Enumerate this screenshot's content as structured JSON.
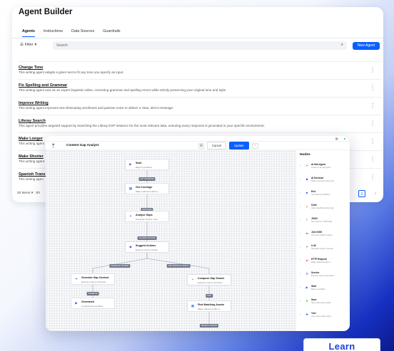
{
  "agent_builder": {
    "title": "Agent Builder",
    "tabs": [
      {
        "label": "Agents",
        "active": true
      },
      {
        "label": "Instructions"
      },
      {
        "label": "Data Sources"
      },
      {
        "label": "Guardrails"
      }
    ],
    "filter_label": "Filter",
    "search_placeholder": "Search",
    "new_agent_label": "New Agent",
    "rows": [
      {
        "name": "Change Tone",
        "desc": "This writing agent adapts a given text to fit any tone you specify as input."
      },
      {
        "name": "Fix Spelling and Grammar",
        "desc": "This writing agent acts as an expert linguistic editor, correcting grammar and spelling errors while strictly preserving your original tone and style."
      },
      {
        "name": "Improve Writing",
        "desc": "This writing agent improves text eliminating wordiness and passive voice to deliver a clear, direct message."
      },
      {
        "name": "Liferay Search",
        "desc": "This agent provides targeted support by searching the Liferay DXP instance for the most relevant data, ensuring every response is grounded in your specific environment."
      },
      {
        "name": "Make Longer",
        "desc": "This writing agent"
      },
      {
        "name": "Make Shorter",
        "desc": "This writing agent"
      },
      {
        "name": "Spanish Translat",
        "desc": "This writing agen"
      }
    ],
    "footer_count": "20 Items",
    "footer_show": "Sh",
    "page_current": "1"
  },
  "workflow": {
    "title": "Content Gap Analyst",
    "cancel_label": "Cancel",
    "update_label": "Update",
    "more_label": "···",
    "nodes": [
      {
        "title": "Start",
        "sub": "Begin a workflow",
        "icon": "▶",
        "color": "#6b4de6"
      },
      {
        "title": "Get Coverage",
        "sub": "Make outbound calls to...",
        "icon": "▦",
        "color": "#0b5fff"
      },
      {
        "title": "Analyze Gaps",
        "sub": "Generate content. Auto...",
        "icon": "✦",
        "color": "#6b4de6"
      },
      {
        "title": "Suggest Actions",
        "sub": "Execute custom scripts...",
        "icon": "◆",
        "color": "#6b4de6"
      },
      {
        "title": "Generate Gap Content",
        "sub": "Execute custom instructio...",
        "icon": "✦",
        "color": "#6b4de6"
      },
      {
        "title": "Compose Gap Search",
        "sub": "Execute custom instructio...",
        "icon": "✦",
        "color": "#e39b16"
      },
      {
        "title": "Generated",
        "sub": "Conclude the workflow",
        "icon": "▶",
        "color": "#0b5fff"
      },
      {
        "title": "Find Matching Assets",
        "sub": "Make outbound calls to...",
        "icon": "▦",
        "color": "#0b5fff"
      }
    ],
    "edge_labels": [
      "GET COVERAGE",
      "RESPONSE",
      "SUGGEST ACTIONS",
      "GENERATE CONTENT",
      "FIND MATCHING ASSETS",
      "GENERATE",
      "FIND",
      "SEARCH CONTENT"
    ],
    "panel_title": "Nodes",
    "panel_items": [
      {
        "title": "AI Hub Agent",
        "sub": "Invoke an AI Hub Agent",
        "icon": "✦",
        "color": "#6b4de6"
      },
      {
        "title": "AI Decision",
        "sub": "Make a decision using LLM",
        "icon": "◆",
        "color": "#0b5fff"
      },
      {
        "title": "End",
        "sub": "Conclude the workflow",
        "icon": "■",
        "color": "#0b5fff"
      },
      {
        "title": "Code",
        "sub": "Apply JavaScript code logic",
        "icon": "{}",
        "color": "#e39b16"
      },
      {
        "title": "JSON",
        "sub": "Set output for JSON data",
        "icon": "≡",
        "color": "#6b4de6"
      },
      {
        "title": "Join DOM",
        "sub": "Join and combine outputs",
        "icon": "⇆",
        "color": "#6b4de6"
      },
      {
        "title": "LLM",
        "sub": "Generate content, execute...",
        "icon": "✦",
        "color": "#6b4de6"
      },
      {
        "title": "HTTP Request",
        "sub": "Make outbound calls to...",
        "icon": "⇄",
        "color": "#e0463b"
      },
      {
        "title": "Service",
        "sub": "Execute custom instructions",
        "icon": "⚙",
        "color": "#6b4de6"
      },
      {
        "title": "Start",
        "sub": "Begin a workflow",
        "icon": "▶",
        "color": "#0b5fff"
      },
      {
        "title": "Save",
        "sub": "Save and persist results",
        "icon": "⬇",
        "color": "#1a9f5a"
      },
      {
        "title": "Tool",
        "sub": "Use a tool to take action",
        "icon": "✚",
        "color": "#0b5fff"
      }
    ]
  },
  "learn_label": "Learn"
}
